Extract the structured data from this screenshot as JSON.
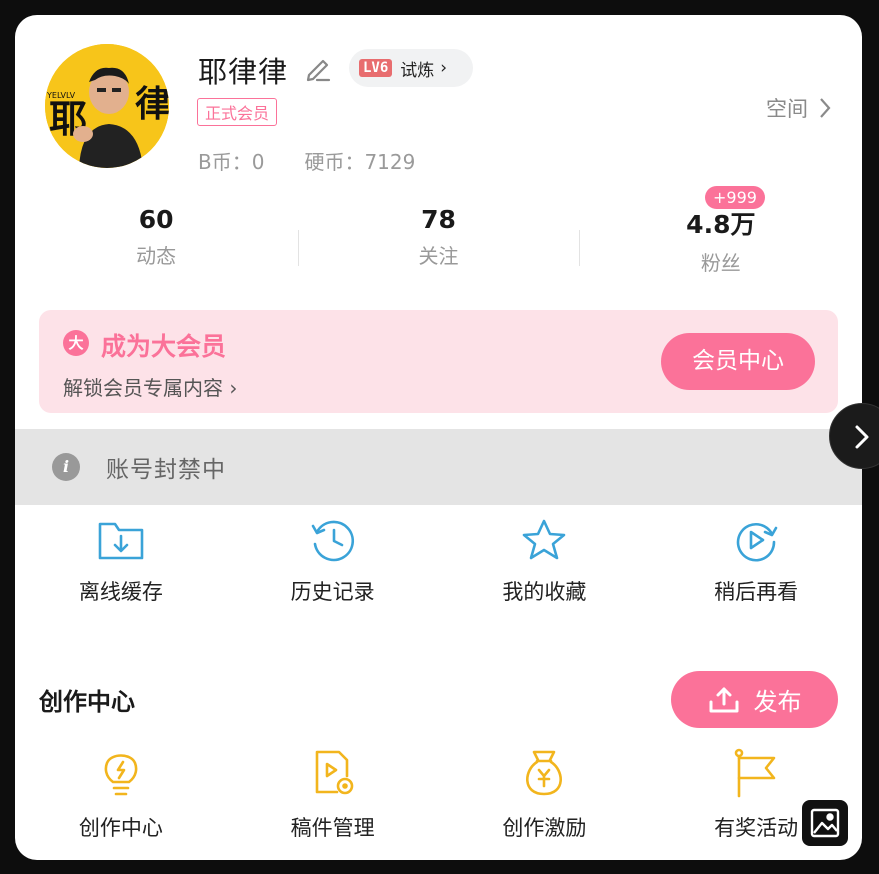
{
  "profile": {
    "username": "耶律律",
    "level_badge": "LV6",
    "level_text": "试炼",
    "member_tag": "正式会员",
    "bcoin": "B币：0",
    "hardcoin": "硬币：7129",
    "space_label": "空间",
    "avatar_text": "耶",
    "avatar_text2": "律",
    "avatar_small": "YELVLV"
  },
  "stats": [
    {
      "value": "60",
      "label": "动态"
    },
    {
      "value": "78",
      "label": "关注"
    },
    {
      "value": "4.8万",
      "label": "粉丝",
      "badge": "+999"
    }
  ],
  "vip": {
    "icon_char": "大",
    "title": "成为大会员",
    "subtitle": "解锁会员专属内容",
    "button": "会员中心"
  },
  "ban": {
    "icon_char": "i",
    "text": "账号封禁中"
  },
  "quick": [
    {
      "label": "离线缓存",
      "icon": "download-folder-icon"
    },
    {
      "label": "历史记录",
      "icon": "history-icon"
    },
    {
      "label": "我的收藏",
      "icon": "star-icon"
    },
    {
      "label": "稍后再看",
      "icon": "watch-later-icon"
    }
  ],
  "creator": {
    "title": "创作中心",
    "publish": "发布",
    "items": [
      {
        "label": "创作中心",
        "icon": "lightbulb-icon"
      },
      {
        "label": "稿件管理",
        "icon": "manuscript-icon"
      },
      {
        "label": "创作激励",
        "icon": "money-bag-icon"
      },
      {
        "label": "有奖活动",
        "icon": "flag-icon"
      }
    ]
  },
  "colors": {
    "accent": "#fb7299",
    "blue_icon": "#3aa3d8",
    "yellow_icon": "#f2b51d"
  }
}
